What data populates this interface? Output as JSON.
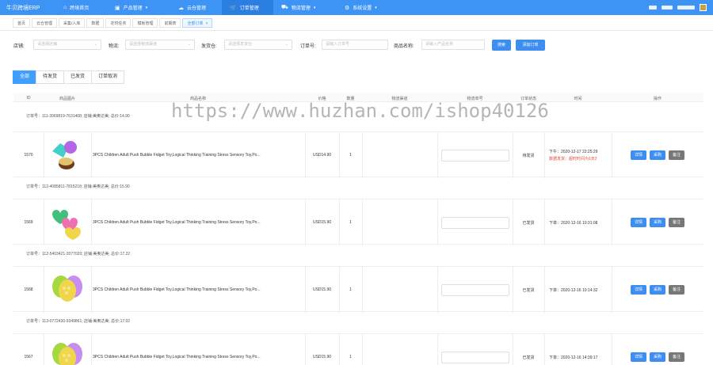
{
  "app": {
    "title": "牛贝跨境ERP"
  },
  "nav": {
    "items": [
      {
        "label": "跨境首页",
        "icon": "home-icon",
        "active": false
      },
      {
        "label": "产品管理",
        "icon": "box-icon",
        "active": false,
        "caret": true
      },
      {
        "label": "云仓管理",
        "icon": "cloud-icon",
        "active": false
      },
      {
        "label": "订单管理",
        "icon": "cart-icon",
        "active": true
      },
      {
        "label": "物流管理",
        "icon": "truck-icon",
        "active": false,
        "caret": true
      },
      {
        "label": "系统设置",
        "icon": "gear-icon",
        "active": false,
        "caret": true
      }
    ]
  },
  "tags": {
    "items": [
      "首页",
      "云仓管理",
      "采集/入库",
      "数据",
      "定时任务",
      "模板管理",
      "前期表"
    ],
    "active_label": "全部订单",
    "close_glyph": "×"
  },
  "filters": {
    "store_label": "店铺:",
    "store_placeholder": "请选择店铺",
    "logistics_label": "物流:",
    "logistics_placeholder": "请选择物流渠道",
    "shipper_label": "发货仓:",
    "shipper_placeholder": "请选择发货仓",
    "order_label": "订单号:",
    "order_placeholder": "请输入订单号",
    "product_label": "商品名称:",
    "product_placeholder": "请输入产品名称",
    "search_button": "搜索",
    "add_button": "添加订单"
  },
  "status_tabs": [
    "全部",
    "待发货",
    "已发货",
    "订单取消"
  ],
  "table": {
    "columns": [
      "ID",
      "商品图片",
      "商品名称",
      "价格",
      "数量",
      "物流渠道",
      "物流单号",
      "订单状态",
      "时间",
      "操作"
    ],
    "rows": [
      {
        "header": "订单号：111-3969819-7631408; 店铺:美奥达美; 总价:14.90",
        "id": "1570",
        "title": "3PCS Children Adult Push Bubble Fidget Toy,Logical Thinking Training Stress Sensory Toy,Po...",
        "price": "USD14.90",
        "qty": "1",
        "status": "待发货",
        "time": "下午：2020-12-17 22:25:29",
        "warning": "数据发货：超时时间为1天2",
        "image": "shapes"
      },
      {
        "header": "订单号：112-4085811-7815218; 店铺:美奥达美; 总价:15.90",
        "id": "1569",
        "title": "3PCS Children Adult Push Bubble Fidget Toy,Logical Thinking Training Stress Sensory Toy,Po...",
        "price": "USD15.90",
        "qty": "1",
        "status": "已发货",
        "time": "下单：2020-12-16 10:31:08",
        "warning": "",
        "image": "hearts"
      },
      {
        "header": "订单号：112-5403421-2077020; 店铺:美奥达美; 总价:17.22",
        "id": "1568",
        "title": "3PCS Children Adult Push Bubble Fidget Toy,Logical Thinking Training Stress Sensory Toy,Po...",
        "price": "USD15.90",
        "qty": "1",
        "status": "已发货",
        "time": "下单：2020-12-16 10:14:32",
        "warning": "",
        "image": "balloons"
      },
      {
        "header": "订单号：113-0772430-9349861; 店铺:美奥达美; 总价:17.02",
        "id": "1567",
        "title": "3PCS Children Adult Push Bubble Fidget Toy,Logical Thinking Training Stress Sensory Toy,Po...",
        "price": "USD15.90",
        "qty": "1",
        "status": "已发货",
        "time": "下单：2020-12-16 14:39:17",
        "warning": "",
        "image": "balloons"
      }
    ],
    "row_actions": [
      "详情",
      "采购",
      "备注"
    ]
  },
  "watermark": "https://www.huzhan.com/ishop40126",
  "colors": {
    "nav": "#3d94f5",
    "primary": "#3d8ef0",
    "warning": "#e54a3c",
    "gray_button": "#777777"
  }
}
